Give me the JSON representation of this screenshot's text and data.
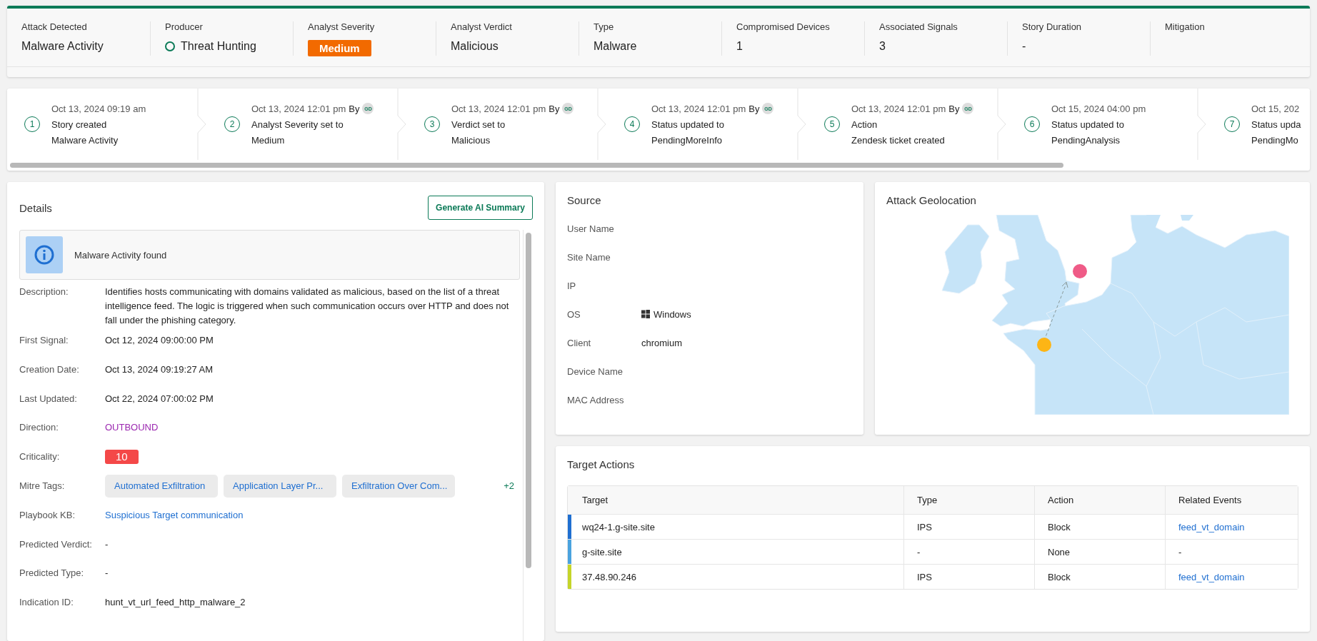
{
  "summary": [
    {
      "label": "Attack Detected",
      "value": "Malware Activity",
      "kind": "text"
    },
    {
      "label": "Producer",
      "value": "Threat Hunting",
      "kind": "producer"
    },
    {
      "label": "Analyst Severity",
      "value": "Medium",
      "kind": "badge",
      "color": "#f26a00"
    },
    {
      "label": "Analyst Verdict",
      "value": "Malicious",
      "kind": "text"
    },
    {
      "label": "Type",
      "value": "Malware",
      "kind": "text"
    },
    {
      "label": "Compromised Devices",
      "value": "1",
      "kind": "text"
    },
    {
      "label": "Associated Signals",
      "value": "3",
      "kind": "text"
    },
    {
      "label": "Story Duration",
      "value": "-",
      "kind": "text"
    },
    {
      "label": "Mitigation"
    }
  ],
  "timeline": [
    {
      "number": "1",
      "time": "Oct 13, 2024 09:19 am",
      "title": "Story created",
      "detail": "Malware Activity"
    },
    {
      "number": "2",
      "time": "Oct 13, 2024 12:01 pm",
      "by": "By",
      "user": "GD",
      "title": "Analyst Severity set to",
      "detail": "Medium"
    },
    {
      "number": "3",
      "time": "Oct 13, 2024 12:01 pm",
      "by": "By",
      "user": "GD",
      "title": "Verdict set to",
      "detail": "Malicious"
    },
    {
      "number": "4",
      "time": "Oct 13, 2024 12:01 pm",
      "by": "By",
      "user": "GD",
      "title": "Status updated to",
      "detail": "PendingMoreInfo"
    },
    {
      "number": "5",
      "time": "Oct 13, 2024 12:01 pm",
      "by": "By",
      "user": "GD",
      "title": "Action",
      "detail": "Zendesk ticket created"
    },
    {
      "number": "6",
      "time": "Oct 15, 2024 04:00 pm",
      "title": "Status updated to",
      "detail": "PendingAnalysis"
    },
    {
      "number": "7",
      "time": "Oct 15, 202",
      "title": "Status upda",
      "detail": "PendingMo"
    }
  ],
  "details": {
    "title": "Details",
    "ai_button": "Generate AI Summary",
    "alert": "Malware Activity found",
    "rows": [
      {
        "label": "Description:",
        "kind": "text",
        "value": "Identifies hosts communicating with domains validated as malicious, based on the list of a threat intelligence feed. The logic is triggered when such communication occurs over HTTP and does not fall under the phishing category."
      },
      {
        "label": "First Signal:",
        "kind": "text",
        "value": "Oct 12, 2024 09:00:00 PM"
      },
      {
        "label": "Creation Date:",
        "kind": "text",
        "value": "Oct 13, 2024 09:19:27 AM"
      },
      {
        "label": "Last Updated:",
        "kind": "text",
        "value": "Oct 22, 2024 07:00:02 PM"
      },
      {
        "label": "Direction:",
        "kind": "direction",
        "value": "OUTBOUND"
      },
      {
        "label": "Criticality:",
        "kind": "badge",
        "value": "10",
        "color": "#f44848"
      },
      {
        "label": "Mitre Tags:",
        "kind": "tags",
        "tags": [
          "Automated Exfiltration",
          "Application Layer Pr...",
          "Exfiltration Over Com..."
        ],
        "more": "+2"
      },
      {
        "label": "Playbook KB:",
        "kind": "link",
        "value": "Suspicious Target communication"
      },
      {
        "label": "Predicted Verdict:",
        "kind": "text",
        "value": "-"
      },
      {
        "label": "Predicted Type:",
        "kind": "text",
        "value": "-"
      },
      {
        "label": "Indication ID:",
        "kind": "text",
        "value": "hunt_vt_url_feed_http_malware_2"
      }
    ]
  },
  "source": {
    "title": "Source",
    "rows": [
      {
        "label": "User Name"
      },
      {
        "label": "Site Name"
      },
      {
        "label": "IP"
      },
      {
        "label": "OS",
        "value": "Windows",
        "kind": "os"
      },
      {
        "label": "Client",
        "value": "chromium",
        "kind": "text"
      },
      {
        "label": "Device Name"
      },
      {
        "label": "MAC Address"
      }
    ]
  },
  "geolocation": {
    "title": "Attack Geolocation"
  },
  "target_actions": {
    "title": "Target Actions",
    "columns": [
      "Target",
      "Type",
      "Action",
      "Related Events"
    ],
    "rows": [
      {
        "color": "#1f6fd1",
        "target": "wq24-1.g-site.site",
        "type": "IPS",
        "action": "Block",
        "related": "feed_vt_domain",
        "kind": "link"
      },
      {
        "color": "#4aa3df",
        "target": "g-site.site",
        "type": "-",
        "action": "None",
        "related": "-",
        "kind": "text"
      },
      {
        "color": "#c5d52a",
        "target": "37.48.90.246",
        "type": "IPS",
        "action": "Block",
        "related": "feed_vt_domain",
        "kind": "link"
      }
    ]
  }
}
